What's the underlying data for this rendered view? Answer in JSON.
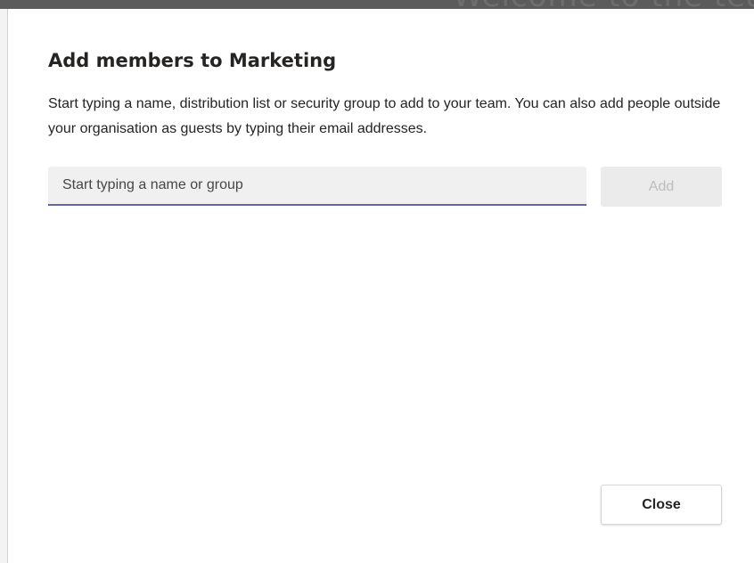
{
  "background": {
    "heading_fragment": "Welcome to the team",
    "strip_color": "#5b5b5b"
  },
  "dialog": {
    "title": "Add members to Marketing",
    "description": "Start typing a name, distribution list or security group to add to your team. You can also add people outside your organisation as guests by typing their email addresses.",
    "search": {
      "placeholder": "Start typing a name or group",
      "value": ""
    },
    "add_label": "Add",
    "close_label": "Close"
  },
  "colors": {
    "accent": "#6264a7",
    "text": "#252423",
    "disabled_text": "#bdbdbd"
  }
}
